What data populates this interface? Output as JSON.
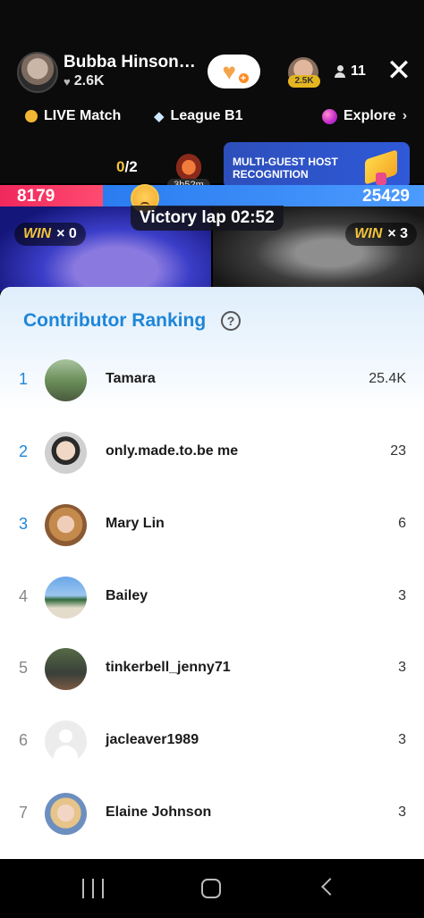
{
  "host": {
    "name": "Bubba Hinson…",
    "likes": "2.6K"
  },
  "viewer": {
    "badge": "2.5K",
    "count": "11"
  },
  "nav": {
    "live_match": "LIVE Match",
    "league": "League B1",
    "explore": "Explore"
  },
  "match": {
    "round_current": "0",
    "round_total": "/2",
    "timer": "3h52m",
    "promo": "MULTI-GUEST HOST RECOGNITION",
    "score_left": "8179",
    "score_right": "25429",
    "victory": "Victory lap 02:52",
    "win_label": "WIN",
    "win_left": "× 0",
    "win_right": "× 3"
  },
  "ranking": {
    "title": "Contributor Ranking",
    "help": "?",
    "items": [
      {
        "rank": "1",
        "name": "Tamara",
        "score": "25.4K"
      },
      {
        "rank": "2",
        "name": "only.made.to.be me",
        "score": "23"
      },
      {
        "rank": "3",
        "name": "Mary Lin",
        "score": "6"
      },
      {
        "rank": "4",
        "name": "Bailey",
        "score": "3"
      },
      {
        "rank": "5",
        "name": "tinkerbell_jenny71",
        "score": "3"
      },
      {
        "rank": "6",
        "name": "jacleaver1989",
        "score": "3"
      },
      {
        "rank": "7",
        "name": "Elaine Johnson",
        "score": "3"
      }
    ]
  },
  "colors": {
    "accent": "#1e86d8",
    "score_red": "#f0285d",
    "score_blue": "#2a7cf0",
    "gold": "#f2c43a"
  },
  "score_share": {
    "left": 0.243,
    "right": 0.757
  }
}
